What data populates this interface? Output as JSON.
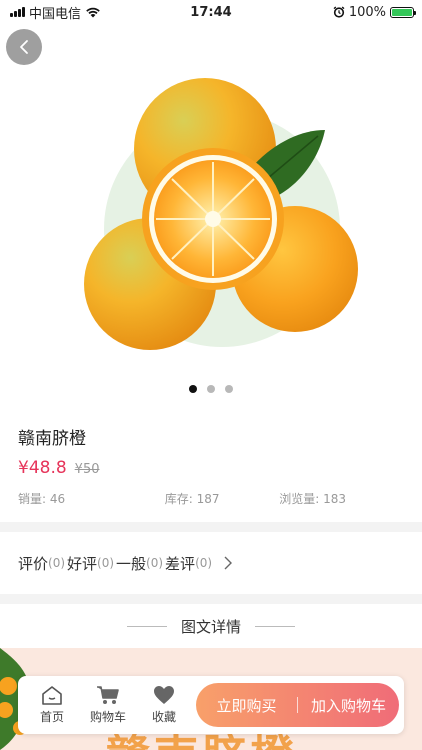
{
  "status": {
    "carrier": "中国电信",
    "time": "17:44",
    "battery": "100%"
  },
  "gallery": {
    "slide_count": 3,
    "active_index": 0
  },
  "product": {
    "title": "赣南脐橙",
    "price": "¥48.8",
    "original_price": "¥50",
    "sales": "销量: 46",
    "stock": "库存: 187",
    "views": "浏览量: 183"
  },
  "reviews": {
    "label_total": "评价",
    "count_total": "(0)",
    "label_good": "好评",
    "count_good": "(0)",
    "label_normal": "一般",
    "count_normal": "(0)",
    "label_bad": "差评",
    "count_bad": "(0)"
  },
  "detail": {
    "heading": "图文详情",
    "banner_text": "赣南脐橙"
  },
  "bottom_bar": {
    "home": "首页",
    "cart": "购物车",
    "favorite": "收藏",
    "buy_now": "立即购买",
    "add_to_cart": "加入购物车"
  },
  "colors": {
    "price": "#e6345a",
    "cta_start": "#f8a06a",
    "cta_end": "#f06c78"
  }
}
